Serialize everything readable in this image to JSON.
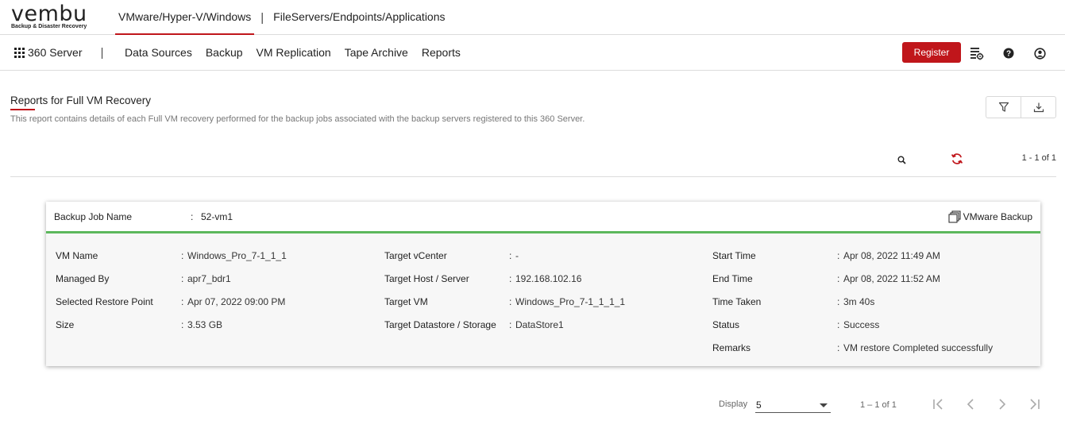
{
  "brand": {
    "name": "vembu",
    "tagline": "Backup & Disaster Recovery"
  },
  "top_tabs": [
    {
      "label": "VMware/Hyper-V/Windows",
      "active": true
    },
    {
      "label": "FileServers/Endpoints/Applications",
      "active": false
    }
  ],
  "top_separator": "|",
  "nav": {
    "server_label": "360 Server",
    "items": [
      "Data Sources",
      "Backup",
      "VM Replication",
      "Tape Archive",
      "Reports"
    ],
    "register_label": "Register"
  },
  "page": {
    "title": "Reports for Full VM Recovery",
    "description": "This report contains details of each Full VM recovery performed for the backup jobs associated with the backup servers registered to this 360 Server.",
    "top_pagination": "1 - 1 of 1"
  },
  "card": {
    "job_label": "Backup Job Name",
    "colon": ":",
    "job_value": "52-vm1",
    "backup_type": "VMware Backup",
    "fields": [
      {
        "label": "VM Name",
        "value": "Windows_Pro_7-1_1_1"
      },
      {
        "label": "Managed By",
        "value": "apr7_bdr1"
      },
      {
        "label": "Selected Restore Point",
        "value": "Apr 07, 2022 09:00 PM"
      },
      {
        "label": "Size",
        "value": "3.53 GB"
      },
      {
        "label": "Target vCenter",
        "value": "-"
      },
      {
        "label": "Target Host / Server",
        "value": "192.168.102.16"
      },
      {
        "label": "Target VM",
        "value": "Windows_Pro_7-1_1_1_1"
      },
      {
        "label": "Target Datastore / Storage",
        "value": "DataStore1"
      },
      {
        "label": "Start Time",
        "value": "Apr 08, 2022 11:49 AM"
      },
      {
        "label": "End Time",
        "value": "Apr 08, 2022 11:52 AM"
      },
      {
        "label": "Time Taken",
        "value": "3m 40s"
      },
      {
        "label": "Status",
        "value": "Success"
      },
      {
        "label": "Remarks",
        "value": "VM restore Completed successfully"
      }
    ]
  },
  "pagination": {
    "display_label": "Display",
    "page_size": "5",
    "range": "1 – 1 of 1"
  },
  "colors": {
    "accent": "#c0161b",
    "success": "#5cb85c"
  },
  "icons": {
    "apps": "grid-icon",
    "settings": "report-settings-icon",
    "help": "help-icon",
    "account": "account-icon",
    "filter": "filter-icon",
    "download": "download-icon",
    "search": "search-icon",
    "refresh": "refresh-icon",
    "backup_type": "vmware-icon"
  }
}
